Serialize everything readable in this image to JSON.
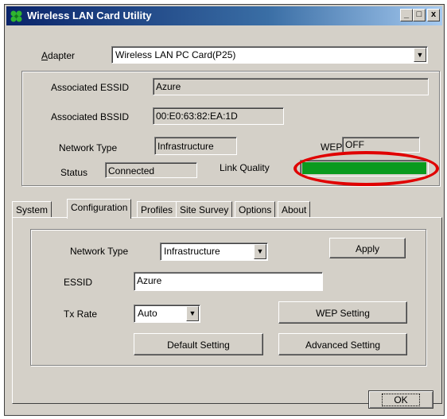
{
  "window": {
    "title": "Wireless LAN Card Utility",
    "controls": {
      "minimize": "_",
      "maximize": "□",
      "close": "x"
    }
  },
  "adapter": {
    "label_first": "A",
    "label_rest": "dapter",
    "selected": "Wireless LAN PC Card(P25)"
  },
  "status_panel": {
    "essid_label": "Associated ESSID",
    "essid_value": "Azure",
    "bssid_label": "Associated BSSID",
    "bssid_value": "00:E0:63:82:EA:1D",
    "network_type_label": "Network Type",
    "network_type_value": "Infrastructure",
    "wep_label": "WEP",
    "wep_value": "OFF",
    "status_label": "Status",
    "status_value": "Connected",
    "link_quality_label": "Link Quality",
    "link_quality_level": 1.0,
    "link_quality_color": "#0a9a1e",
    "highlight_color": "#e00000"
  },
  "tabs": [
    {
      "label": "System"
    },
    {
      "label": "Configuration"
    },
    {
      "label": "Profiles"
    },
    {
      "label": "Site Survey"
    },
    {
      "label": "Options"
    },
    {
      "label": "About"
    }
  ],
  "config": {
    "network_type_label": "Network Type",
    "network_type_value": "Infrastructure",
    "apply_label": "Apply",
    "essid_label": "ESSID",
    "essid_value": "Azure",
    "txrate_label": "Tx Rate",
    "txrate_value": "Auto",
    "wep_setting_label": "WEP Setting",
    "default_setting_label": "Default Setting",
    "advanced_setting_label": "Advanced Setting"
  },
  "footer": {
    "ok_label": "OK"
  }
}
